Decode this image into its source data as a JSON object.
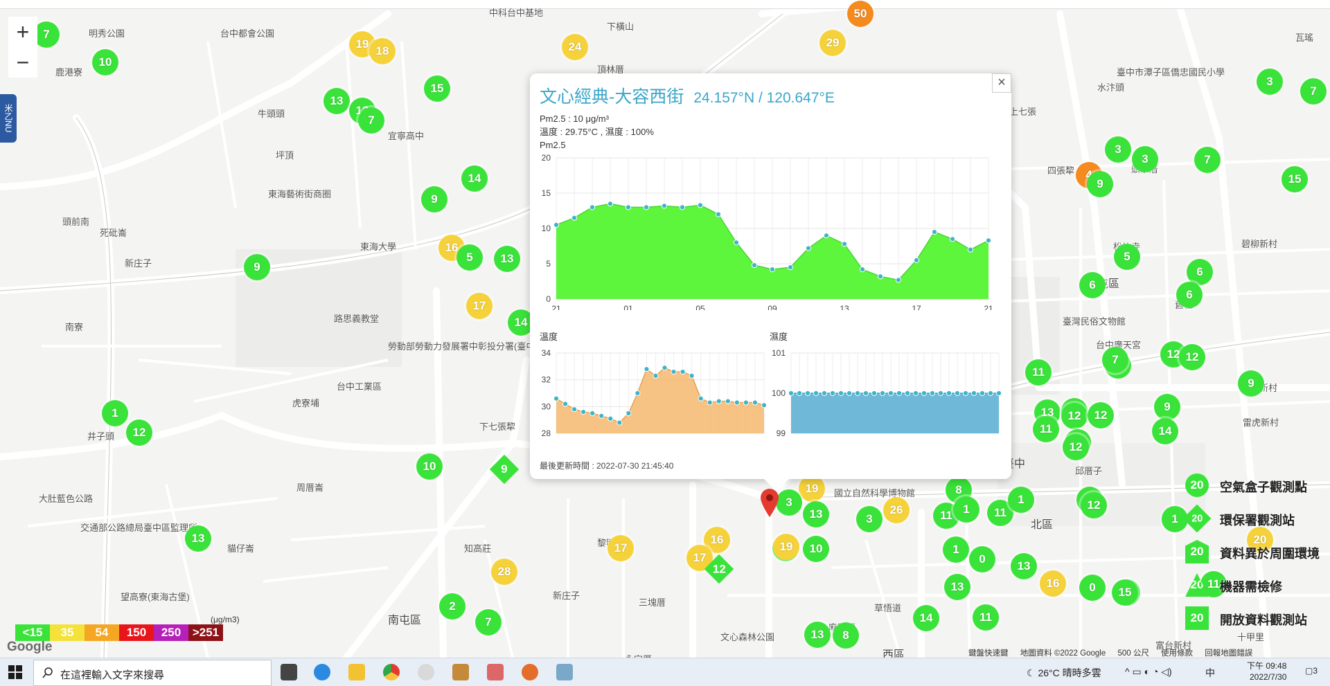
{
  "map": {
    "places": [
      "明秀公園",
      "台中都會公園",
      "中科台中基地",
      "下橫山",
      "頂林厝",
      "鹿港寮",
      "牛頭頭",
      "坪頂",
      "東海藝術街商圈",
      "宜寧高中",
      "頭前南",
      "死砒崙",
      "新庄子",
      "東海大學",
      "路思義教堂",
      "勞動部勞動力發展署中彰投分署(臺中職訓局)",
      "台中工業區",
      "虎寮埔",
      "井子頭",
      "周厝崙",
      "大肚藍色公路",
      "交通部公路總局臺中區監理所",
      "貓仔崙",
      "知高莊",
      "下七張犂",
      "黎明",
      "新庄子",
      "三塊厝",
      "文心森林公園",
      "麻園頭",
      "西區",
      "國立自然科學博物館",
      "北區",
      "北屯區",
      "臺中",
      "邱厝子",
      "四張犂",
      "水湳",
      "上七張",
      "頭家厝",
      "松竹寺",
      "舊社",
      "碧柳新村",
      "臺灣民俗文物館",
      "台中廣天宮",
      "雷虎新村",
      "玫瑰新村",
      "十甲里",
      "富台新村",
      "草悟道",
      "望高寮(東海古堡)",
      "南屯區",
      "永定厝",
      "南寮",
      "瓦瑤",
      "臺中市潭子區僑忠國民小學",
      "水汴頭"
    ],
    "markers": [
      {
        "v": "7",
        "c": "green"
      },
      {
        "v": "10",
        "c": "green"
      },
      {
        "v": "19",
        "c": "yellow"
      },
      {
        "v": "18",
        "c": "yellow"
      },
      {
        "v": "13",
        "c": "green"
      },
      {
        "v": "13",
        "c": "green"
      },
      {
        "v": "7",
        "c": "green"
      },
      {
        "v": "15",
        "c": "green"
      },
      {
        "v": "24",
        "c": "yellow"
      },
      {
        "v": "29",
        "c": "yellow"
      },
      {
        "v": "50",
        "c": "orange"
      },
      {
        "v": "14",
        "c": "green"
      },
      {
        "v": "9",
        "c": "green"
      },
      {
        "v": "16",
        "c": "yellow"
      },
      {
        "v": "5",
        "c": "green"
      },
      {
        "v": "13",
        "c": "green"
      },
      {
        "v": "17",
        "c": "yellow"
      },
      {
        "v": "9",
        "c": "green"
      },
      {
        "v": "14",
        "c": "green"
      },
      {
        "v": "1",
        "c": "green"
      },
      {
        "v": "12",
        "c": "green"
      },
      {
        "v": "10",
        "c": "green"
      },
      {
        "v": "13",
        "c": "green"
      },
      {
        "v": "28",
        "c": "yellow"
      },
      {
        "v": "2",
        "c": "green"
      },
      {
        "v": "7",
        "c": "green"
      },
      {
        "v": "17",
        "c": "yellow"
      },
      {
        "v": "16",
        "c": "yellow"
      },
      {
        "v": "17",
        "c": "yellow"
      },
      {
        "v": "19",
        "c": "yellow"
      },
      {
        "v": "3",
        "c": "green"
      },
      {
        "v": "13",
        "c": "green"
      },
      {
        "v": "10",
        "c": "green"
      },
      {
        "v": "19",
        "c": "yellow"
      },
      {
        "v": "10",
        "c": "green"
      },
      {
        "v": "3",
        "c": "green"
      },
      {
        "v": "26",
        "c": "yellow"
      },
      {
        "v": "13",
        "c": "green"
      },
      {
        "v": "8",
        "c": "green"
      },
      {
        "v": "11",
        "c": "green"
      },
      {
        "v": "8",
        "c": "green"
      },
      {
        "v": "1",
        "c": "green"
      },
      {
        "v": "11",
        "c": "green"
      },
      {
        "v": "1",
        "c": "green"
      },
      {
        "v": "12",
        "c": "green"
      },
      {
        "v": "1",
        "c": "green"
      },
      {
        "v": "0",
        "c": "green"
      },
      {
        "v": "13",
        "c": "green"
      },
      {
        "v": "13",
        "c": "green"
      },
      {
        "v": "14",
        "c": "green"
      },
      {
        "v": "11",
        "c": "green"
      },
      {
        "v": "13",
        "c": "green"
      },
      {
        "v": "11",
        "c": "green"
      },
      {
        "v": "11",
        "c": "green"
      },
      {
        "v": "13",
        "c": "green"
      },
      {
        "v": "12",
        "c": "green"
      },
      {
        "v": "14",
        "c": "green"
      },
      {
        "v": "12",
        "c": "green"
      },
      {
        "v": "12",
        "c": "green"
      },
      {
        "v": "7",
        "c": "green"
      },
      {
        "v": "6",
        "c": "green"
      },
      {
        "v": "5",
        "c": "green"
      },
      {
        "v": "7",
        "c": "green"
      },
      {
        "v": "3",
        "c": "green"
      },
      {
        "v": "4",
        "c": "orange"
      },
      {
        "v": "9",
        "c": "green"
      },
      {
        "v": "3",
        "c": "green"
      },
      {
        "v": "7",
        "c": "green"
      },
      {
        "v": "15",
        "c": "green"
      },
      {
        "v": "3",
        "c": "green"
      },
      {
        "v": "7",
        "c": "green"
      },
      {
        "v": "1",
        "c": "green"
      },
      {
        "v": "6",
        "c": "green"
      },
      {
        "v": "6",
        "c": "green"
      },
      {
        "v": "12",
        "c": "green"
      },
      {
        "v": "12",
        "c": "green"
      },
      {
        "v": "9",
        "c": "green"
      },
      {
        "v": "9",
        "c": "green"
      },
      {
        "v": "14",
        "c": "green"
      },
      {
        "v": "12",
        "c": "green"
      },
      {
        "v": "0",
        "c": "green"
      },
      {
        "v": "15",
        "c": "green"
      },
      {
        "v": "16",
        "c": "yellow"
      },
      {
        "v": "20",
        "c": "yellow"
      },
      {
        "v": "15",
        "c": "green"
      },
      {
        "v": "11",
        "c": "green"
      }
    ],
    "diamonds": [
      "9",
      "12"
    ],
    "zoom_in": "+",
    "zoom_out": "−",
    "side_tab": "米乙NU"
  },
  "popup": {
    "title": "文心經典-大容西街",
    "coords": "24.157°N / 120.647°E",
    "close": "×",
    "pm_line": "Pm2.5 : 10 μg/m³",
    "temp_line": "溫度 : 29.75°C , 濕度 : 100%",
    "chart_label": "Pm2.5",
    "temp_label": "溫度",
    "hum_label": "濕度",
    "updated": "最後更新時間 : 2022-07-30 21:45:40"
  },
  "chart_data": [
    {
      "type": "area",
      "title": "Pm2.5",
      "x": [
        "21",
        "",
        "",
        "",
        "01",
        "",
        "",
        "",
        "05",
        "",
        "",
        "",
        "09",
        "",
        "",
        "",
        "13",
        "",
        "",
        "",
        "17",
        "",
        "",
        "",
        "21"
      ],
      "xticks": [
        "21",
        "01",
        "05",
        "09",
        "13",
        "17",
        "21"
      ],
      "values": [
        10.5,
        11.5,
        13,
        13.5,
        13,
        13,
        13.2,
        13,
        13.3,
        12,
        8,
        4.8,
        4.2,
        4.5,
        7.2,
        9,
        7.8,
        4.2,
        3.2,
        2.7,
        5.5,
        9.5,
        8.5,
        7,
        8.3
      ],
      "ylim": [
        0,
        20
      ],
      "yticks": [
        0,
        5,
        10,
        15,
        20
      ],
      "color": "#5ef53d"
    },
    {
      "type": "area",
      "title": "溫度",
      "values": [
        30.6,
        30.2,
        29.8,
        29.6,
        29.5,
        29.3,
        29.1,
        28.8,
        29.5,
        31,
        32.8,
        32.3,
        32.9,
        32.6,
        32.6,
        32.3,
        30.6,
        30.3,
        30.4,
        30.4,
        30.3,
        30.3,
        30.3,
        30.1
      ],
      "ylim": [
        28,
        34
      ],
      "yticks": [
        28,
        30,
        32,
        34
      ],
      "color": "#f4b870"
    },
    {
      "type": "area",
      "title": "濕度",
      "values": [
        100,
        100,
        100,
        100,
        100,
        100,
        100,
        100,
        100,
        100,
        100,
        100,
        100,
        100,
        100,
        100,
        100,
        100,
        100,
        100,
        100,
        100,
        100,
        100,
        100,
        100
      ],
      "ylim": [
        99,
        101
      ],
      "yticks": [
        99,
        100,
        101
      ],
      "color": "#6fb8d8"
    }
  ],
  "legend": {
    "unit": "(μg/m3)",
    "items": [
      {
        "label": "<15",
        "color": "#3ae33a"
      },
      {
        "label": "35",
        "color": "#f4e23a"
      },
      {
        "label": "54",
        "color": "#f5a623"
      },
      {
        "label": "150",
        "color": "#e8161b"
      },
      {
        "label": "250",
        "color": "#b620b9"
      },
      {
        "label": ">251",
        "color": "#8c1218"
      }
    ]
  },
  "map_legend": [
    {
      "label": "空氣盒子觀測點",
      "value": "20"
    },
    {
      "label": "環保署觀測站",
      "value": "20"
    },
    {
      "label": "資料異於周圍環境",
      "value": "20"
    },
    {
      "label": "機器需檢修",
      "value": "20"
    },
    {
      "label": "開放資料觀測站",
      "value": "20"
    }
  ],
  "attribution": {
    "shortcuts": "鍵盤快速鍵",
    "data": "地圖資料 ©2022 Google",
    "scale": "500 公尺",
    "terms": "使用條款",
    "report": "回報地圖錯誤",
    "google": "Google"
  },
  "taskbar": {
    "search_placeholder": "在這裡輸入文字來搜尋",
    "weather": "26°C  晴時多雲",
    "ime": "中",
    "time": "下午 09:48",
    "date": "2022/7/30",
    "notif": "3"
  }
}
